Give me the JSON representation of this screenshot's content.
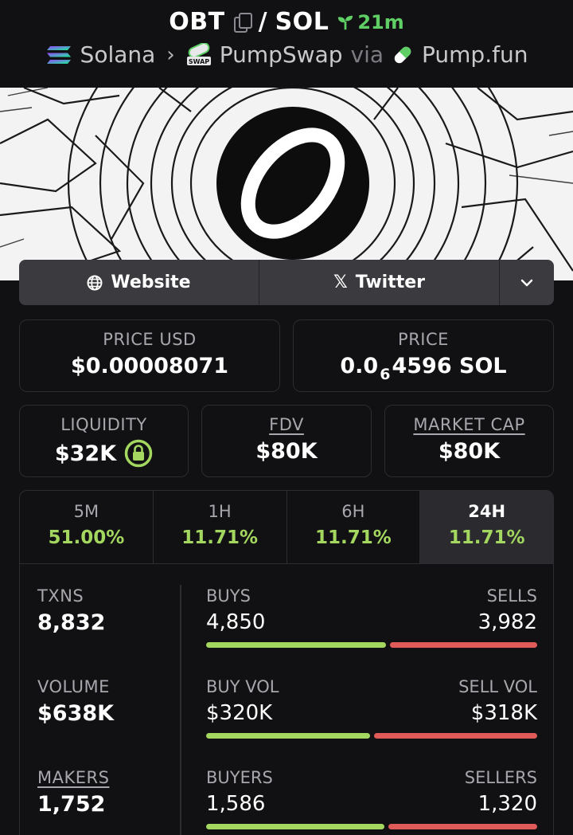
{
  "header": {
    "base_symbol": "OBT",
    "separator": "/",
    "quote_symbol": "SOL",
    "age": "21m",
    "chain": "Solana",
    "dex": "PumpSwap",
    "via_label": "via",
    "launchpad": "Pump.fun",
    "dex_icon_text": "SWAP"
  },
  "links": {
    "website_label": "Website",
    "twitter_label": "Twitter"
  },
  "stats": {
    "price_usd_label": "PRICE USD",
    "price_usd": "$0.00008071",
    "price_label": "PRICE",
    "price_prefix": "0.0",
    "price_zeros": "6",
    "price_digits": "4596 SOL",
    "liquidity_label": "LIQUIDITY",
    "liquidity": "$32K",
    "fdv_label": "FDV",
    "fdv": "$80K",
    "mcap_label": "MARKET CAP",
    "mcap": "$80K"
  },
  "timeframes": [
    {
      "label": "5M",
      "change": "51.00%"
    },
    {
      "label": "1H",
      "change": "11.71%"
    },
    {
      "label": "6H",
      "change": "11.71%"
    },
    {
      "label": "24H",
      "change": "11.71%",
      "active": true
    }
  ],
  "activity": {
    "txns_label": "TXNS",
    "txns": "8,832",
    "buys_label": "BUYS",
    "buys": "4,850",
    "sells_label": "SELLS",
    "sells": "3,982",
    "buys_share": 0.549,
    "volume_label": "VOLUME",
    "volume": "$638K",
    "buy_vol_label": "BUY VOL",
    "buy_vol": "$320K",
    "sell_vol_label": "SELL VOL",
    "sell_vol": "$318K",
    "buy_vol_share": 0.502,
    "makers_label": "MAKERS",
    "makers": "1,752",
    "buyers_label": "BUYERS",
    "buyers": "1,586",
    "sellers_label": "SELLERS",
    "sellers": "1,320",
    "buyers_share": 0.546
  },
  "colors": {
    "positive": "#a4d75f",
    "negative": "#e05a5a",
    "age": "#5fcf65"
  }
}
